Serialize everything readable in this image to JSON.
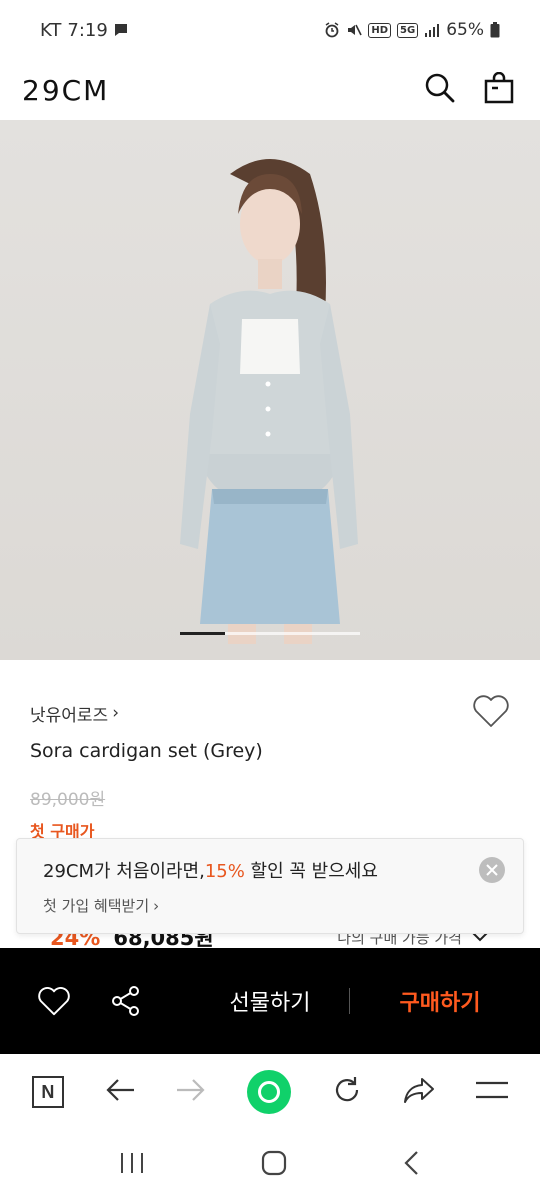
{
  "status_bar": {
    "carrier": "KT",
    "time": "7:19",
    "hd_badge": "HD",
    "net_badge": "5G",
    "battery": "65%"
  },
  "header": {
    "logo": "29CM",
    "icons": [
      "search-icon",
      "shopping-bag-icon"
    ]
  },
  "hero": {
    "slide_index": 1,
    "slide_count": 4
  },
  "product": {
    "brand": "낫유어로즈",
    "brand_chevron": "›",
    "name": "Sora cardigan set (Grey)",
    "original_price": "89,000원",
    "first_price_label": "첫 구매가",
    "discount": "24%",
    "sale_price": "68,085원",
    "my_price_label": "나의 구매 가능 가격"
  },
  "promo_popup": {
    "title_before": "29CM가 처음이라면,",
    "title_highlight": "15%",
    "title_after": " 할인 꼭 받으세요",
    "subtitle": "첫 가입 혜택받기",
    "subtitle_chevron": "›"
  },
  "action_bar": {
    "gift_label": "선물하기",
    "buy_label": "구매하기"
  },
  "browser_bar": {
    "n_label": "N"
  },
  "colors": {
    "accent": "#e8571f",
    "buy": "#ff5a1f",
    "green": "#10d16a"
  }
}
